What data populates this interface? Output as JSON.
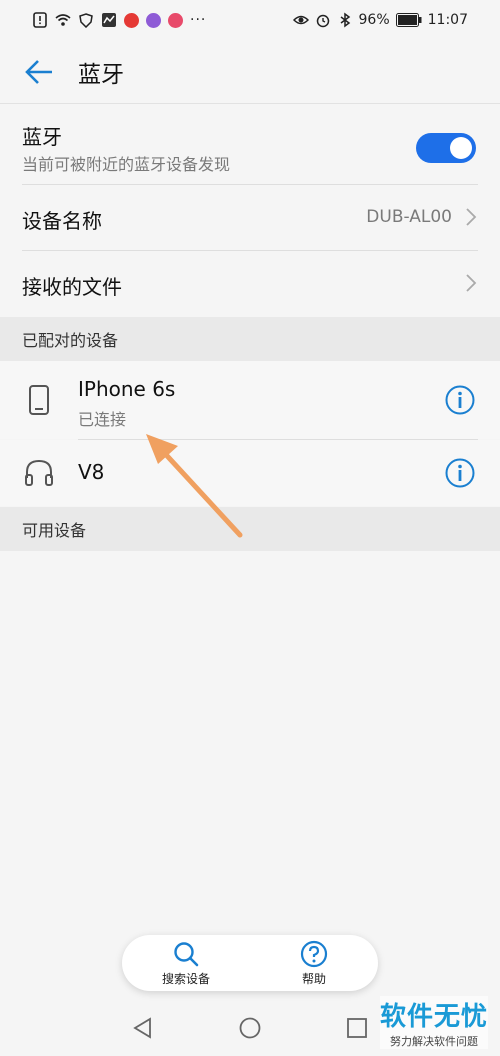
{
  "status_bar": {
    "battery": "96%",
    "time": "11:07"
  },
  "header": {
    "title": "蓝牙"
  },
  "bluetooth": {
    "title": "蓝牙",
    "subtitle": "当前可被附近的蓝牙设备发现",
    "enabled": true
  },
  "device_name": {
    "label": "设备名称",
    "value": "DUB-AL00"
  },
  "received_files": {
    "label": "接收的文件"
  },
  "paired_section": {
    "title": "已配对的设备"
  },
  "paired_devices": [
    {
      "name": "IPhone 6s",
      "status": "已连接",
      "icon": "phone-icon"
    },
    {
      "name": "V8",
      "status": "",
      "icon": "headphones-icon"
    }
  ],
  "available_section": {
    "title": "可用设备"
  },
  "bottom_actions": {
    "search_label": "搜索设备",
    "help_label": "帮助"
  },
  "watermark": {
    "main": "软件无忧",
    "sub": "努力解决软件问题"
  },
  "colors": {
    "accent": "#1e6fe8",
    "icon_blue": "#1a7fd0",
    "arrow": "#f0a060"
  }
}
